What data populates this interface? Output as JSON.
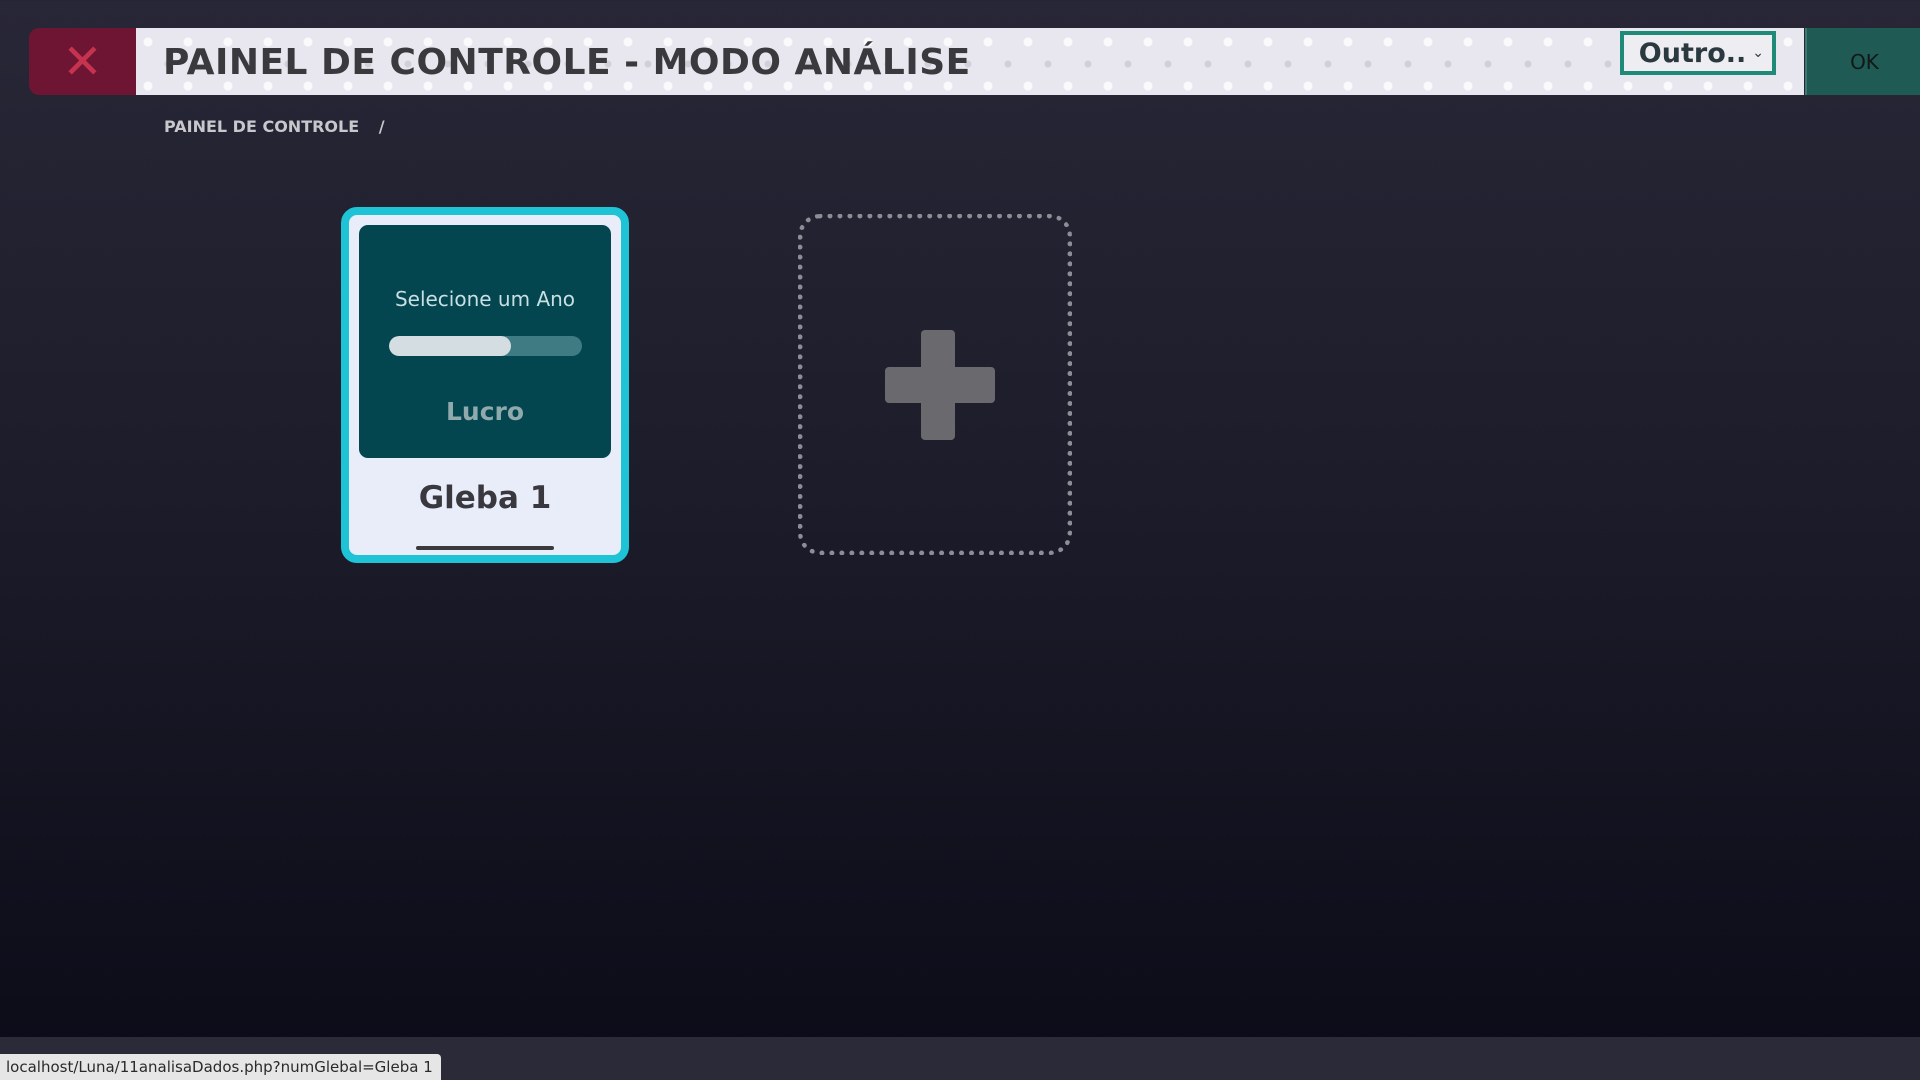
{
  "header": {
    "close_symbol": "✕",
    "title": "PAINEL DE CONTROLE - MODO ANÁLISE",
    "select": {
      "value": "Outro..",
      "chevron": "⌄"
    },
    "ok_label": "OK"
  },
  "breadcrumb": {
    "item": "PAINEL DE CONTROLE",
    "separator": "/"
  },
  "cards": [
    {
      "year_prompt": "Selecione um Ano",
      "progress_percent": 63,
      "metric": "Lucro",
      "name": "Gleba 1"
    }
  ],
  "add_card": {
    "icon": "plus-icon"
  },
  "status_bar": {
    "url": "localhost/Luna/11analisaDados.php?numGlebal=Gleba 1"
  },
  "colors": {
    "accent_teal": "#1ec3d6",
    "card_dark": "#034650",
    "close_red": "#6d1532",
    "ok_green": "#1f5a54",
    "select_border": "#1f8a78"
  }
}
